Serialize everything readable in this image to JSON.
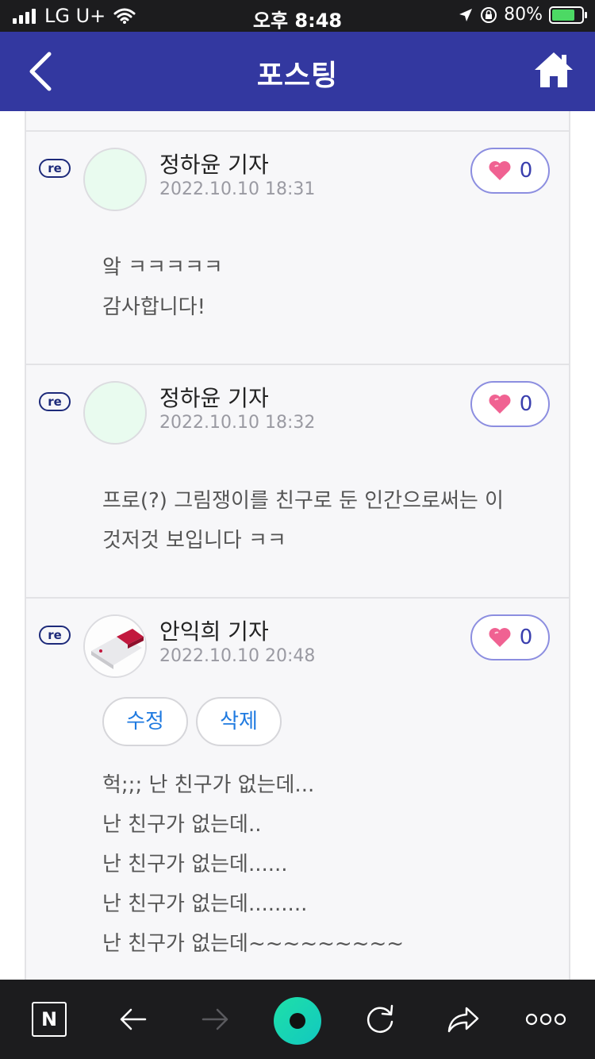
{
  "status_bar": {
    "carrier": "LG U+",
    "time": "오후 8:48",
    "battery": "80%"
  },
  "header": {
    "title": "포스팅"
  },
  "comments": [
    {
      "badge": "re",
      "author": "정하윤 기자",
      "date": "2022.10.10 18:31",
      "likes": "0",
      "lines": [
        "앜 ㅋㅋㅋㅋㅋ",
        "감사합니다!"
      ]
    },
    {
      "badge": "re",
      "author": "정하윤 기자",
      "date": "2022.10.10 18:32",
      "likes": "0",
      "lines": [
        "프로(?) 그림쟁이를 친구로 둔 인간으로써는 이",
        "것저것 보입니다 ㅋㅋ"
      ]
    },
    {
      "badge": "re",
      "author": "안익희 기자",
      "date": "2022.10.10 20:48",
      "likes": "0",
      "edit_label": "수정",
      "delete_label": "삭제",
      "lines": [
        "헉;;; 난 친구가 없는데...",
        "난 친구가 없는데..",
        "난 친구가 없는데......",
        "난 친구가 없는데.........",
        "난 친구가 없는데~~~~~~~~~"
      ]
    }
  ],
  "toolbar": {
    "naver_label": "N",
    "items": [
      "naver-home",
      "back",
      "forward",
      "green-dot",
      "refresh",
      "share",
      "more"
    ]
  },
  "colors": {
    "header_bg": "#3338a0",
    "like_border": "#8c8ee0",
    "action_text": "#1f7ae0",
    "green_dot": "#1ee0a8"
  }
}
